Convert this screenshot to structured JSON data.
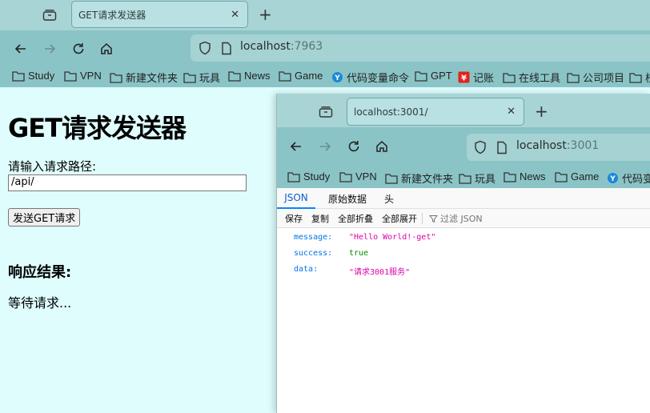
{
  "colors": {
    "tab_bar": "#a8d4d6",
    "toolbar": "#8bc4c6",
    "page_background": "#dffdfd",
    "json_key": "#0074e8",
    "json_string": "#dd00a9",
    "json_boolean": "#058b00",
    "json_active_tab": "#0a84ff"
  },
  "back_window": {
    "tab": {
      "title": "GET请求发送器",
      "close_icon": "close-icon"
    },
    "url": {
      "host": "localhost",
      "port": ":7963"
    },
    "bookmarks": [
      {
        "label": "Study",
        "icon": "folder-icon"
      },
      {
        "label": "VPN",
        "icon": "folder-icon"
      },
      {
        "label": "新建文件夹",
        "icon": "folder-icon"
      },
      {
        "label": "玩具",
        "icon": "folder-icon"
      },
      {
        "label": "News",
        "icon": "folder-icon"
      },
      {
        "label": "Game",
        "icon": "folder-icon"
      },
      {
        "label": "代码变量命令",
        "icon": "site-icon"
      },
      {
        "label": "GPT",
        "icon": "folder-icon"
      },
      {
        "label": "记账",
        "icon": "yen-icon"
      },
      {
        "label": "在线工具",
        "icon": "folder-icon"
      },
      {
        "label": "公司项目",
        "icon": "folder-icon"
      },
      {
        "label": "校",
        "icon": "folder-icon"
      }
    ]
  },
  "page": {
    "title": "GET请求发送器",
    "path_label": "请输入请求路径:",
    "path_value": "/api/",
    "send_button": "发送GET请求",
    "result_heading": "响应结果:",
    "result_text": "等待请求..."
  },
  "front_window": {
    "tab": {
      "title": "localhost:3001/",
      "close_icon": "close-icon"
    },
    "url": {
      "host": "localhost",
      "port": ":3001"
    },
    "bookmarks": [
      {
        "label": "Study",
        "icon": "folder-icon"
      },
      {
        "label": "VPN",
        "icon": "folder-icon"
      },
      {
        "label": "新建文件夹",
        "icon": "folder-icon"
      },
      {
        "label": "玩具",
        "icon": "folder-icon"
      },
      {
        "label": "News",
        "icon": "folder-icon"
      },
      {
        "label": "Game",
        "icon": "folder-icon"
      },
      {
        "label": "代码变",
        "icon": "site-icon"
      }
    ],
    "viewer_tabs": [
      {
        "label": "JSON",
        "active": true
      },
      {
        "label": "原始数据",
        "active": false
      },
      {
        "label": "头",
        "active": false
      }
    ],
    "toolbar": {
      "save": "保存",
      "copy": "复制",
      "collapse_all": "全部折叠",
      "expand_all": "全部展开",
      "filter_placeholder": "过滤 JSON"
    },
    "json": [
      {
        "key": "message:",
        "value": "\"Hello World!-get\"",
        "type": "string"
      },
      {
        "key": "success:",
        "value": "true",
        "type": "boolean"
      },
      {
        "key": "data:",
        "value": "\"请求3001服务\"",
        "type": "string"
      }
    ]
  }
}
